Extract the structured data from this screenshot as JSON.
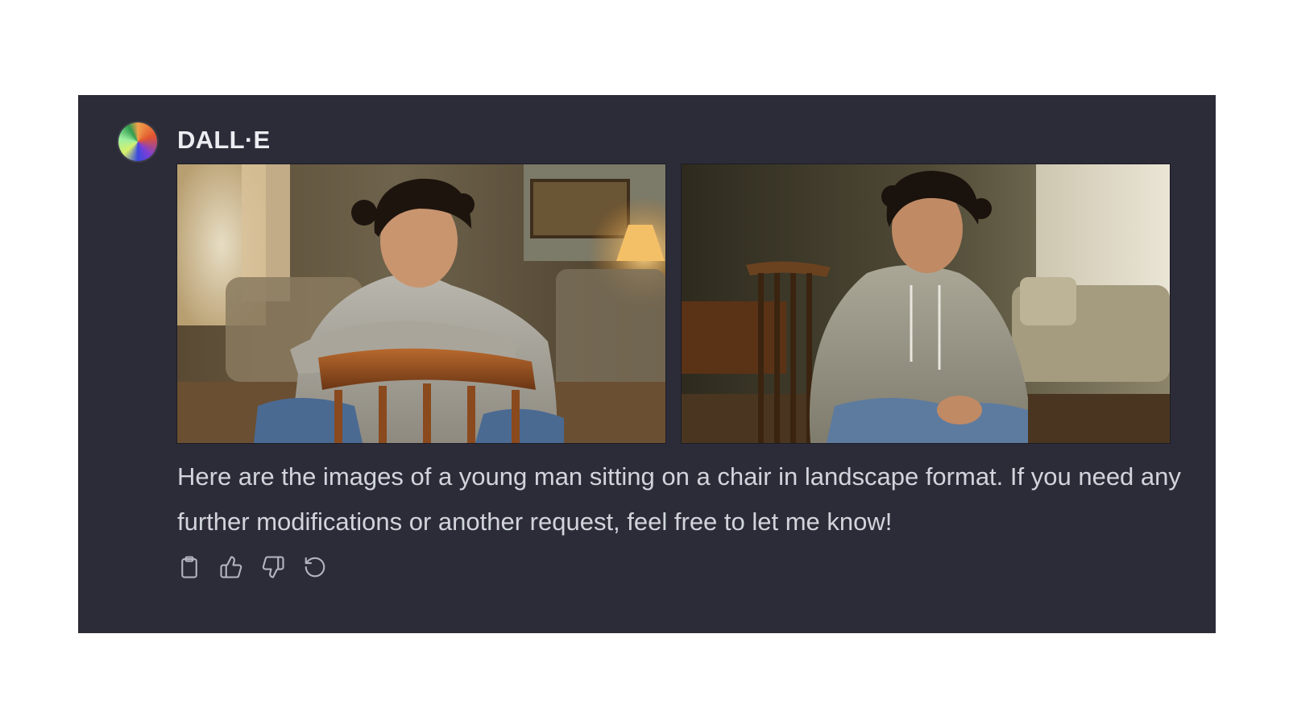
{
  "message": {
    "sender": "DALL·E",
    "avatar_icon": "dalle-avatar-icon",
    "images": [
      {
        "name": "generated-image-1"
      },
      {
        "name": "generated-image-2"
      }
    ],
    "text": "Here are the images of a young man sitting on a chair in landscape format. If you need any further modifications or another request, feel free to let me know!"
  },
  "actions": [
    {
      "name": "copy-button",
      "icon": "clipboard-icon"
    },
    {
      "name": "thumbs-up-button",
      "icon": "thumbs-up-icon"
    },
    {
      "name": "thumbs-down-button",
      "icon": "thumbs-down-icon"
    },
    {
      "name": "regenerate-button",
      "icon": "refresh-icon"
    }
  ],
  "colors": {
    "panel_background": "#2c2c39",
    "text": "#d1d5db",
    "sender": "#ececf1",
    "icon": "#b4b4c0"
  }
}
